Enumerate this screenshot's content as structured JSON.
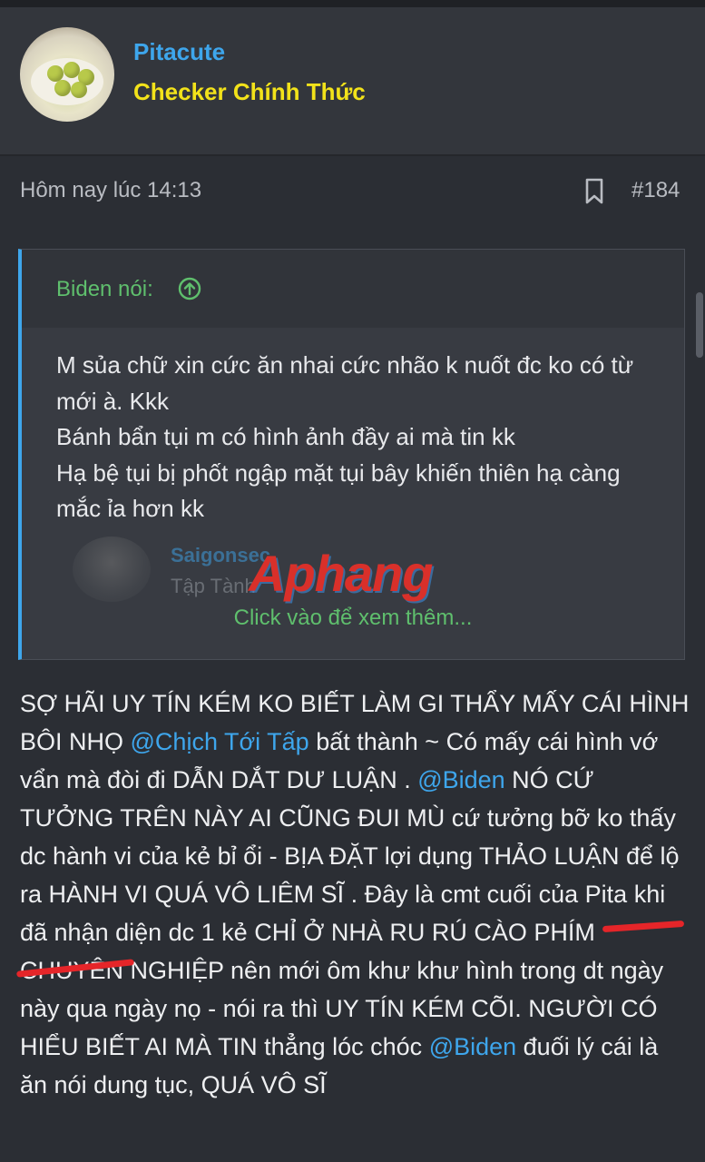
{
  "user": {
    "name": "Pitacute",
    "title": "Checker Chính Thức"
  },
  "post": {
    "time": "Hôm nay lúc 14:13",
    "number": "#184"
  },
  "quote": {
    "author": "Biden nói:",
    "lines": [
      "M sủa chữ xin cức ăn nhai cức nhão k nuốt đc ko có từ mới à. Kkk",
      "Bánh bẩn tụi m có hình ảnh đầy ai mà tin kk",
      "Hạ bệ tụi bị phốt ngập mặt tụi bây khiến thiên hạ càng mắc ỉa hơn kk"
    ],
    "nested_user": "Saigonsec",
    "nested_title": "Tập Tành",
    "expand": "Click vào để xem thêm..."
  },
  "watermark": "Aphang",
  "body": {
    "p1": "SỢ HÃI UY TÍN KÉM KO BIẾT LÀM GI THẨY MẤY CÁI HÌNH BÔI NHỌ ",
    "m1": "@Chịch Tới Tấp",
    "p2": " bất thành ~ Có mấy cái hình vớ vẩn mà đòi đi DẪN DẮT DƯ LUẬN . ",
    "m2": "@Biden",
    "p3": " NÓ CỨ TƯỞNG TRÊN NÀY AI CŨNG ĐUI MÙ cứ tưởng bỡ ko thấy dc hành vi của kẻ bỉ ổi - BỊA ĐẶT lợi dụng THẢO LUẬN để lộ ra HÀNH VI QUÁ VÔ LIÊM SĨ . Đây là cmt cuối của Pita khi đã nhận diện dc 1 kẻ CHỈ Ở NHÀ RU RÚ CÀO PHÍM CHUYÊN NGHIỆP nên mới ôm khư khư hình trong dt ngày này qua ngày nọ - nói ra thì UY TÍN KÉM CÕI. NGƯỜI CÓ HIỂU BIẾT AI MÀ TIN thẳng lóc chóc ",
    "m3": "@Biden",
    "p4": " đuối lý cái là ăn nói dung tục, QUÁ VÔ SĨ"
  }
}
